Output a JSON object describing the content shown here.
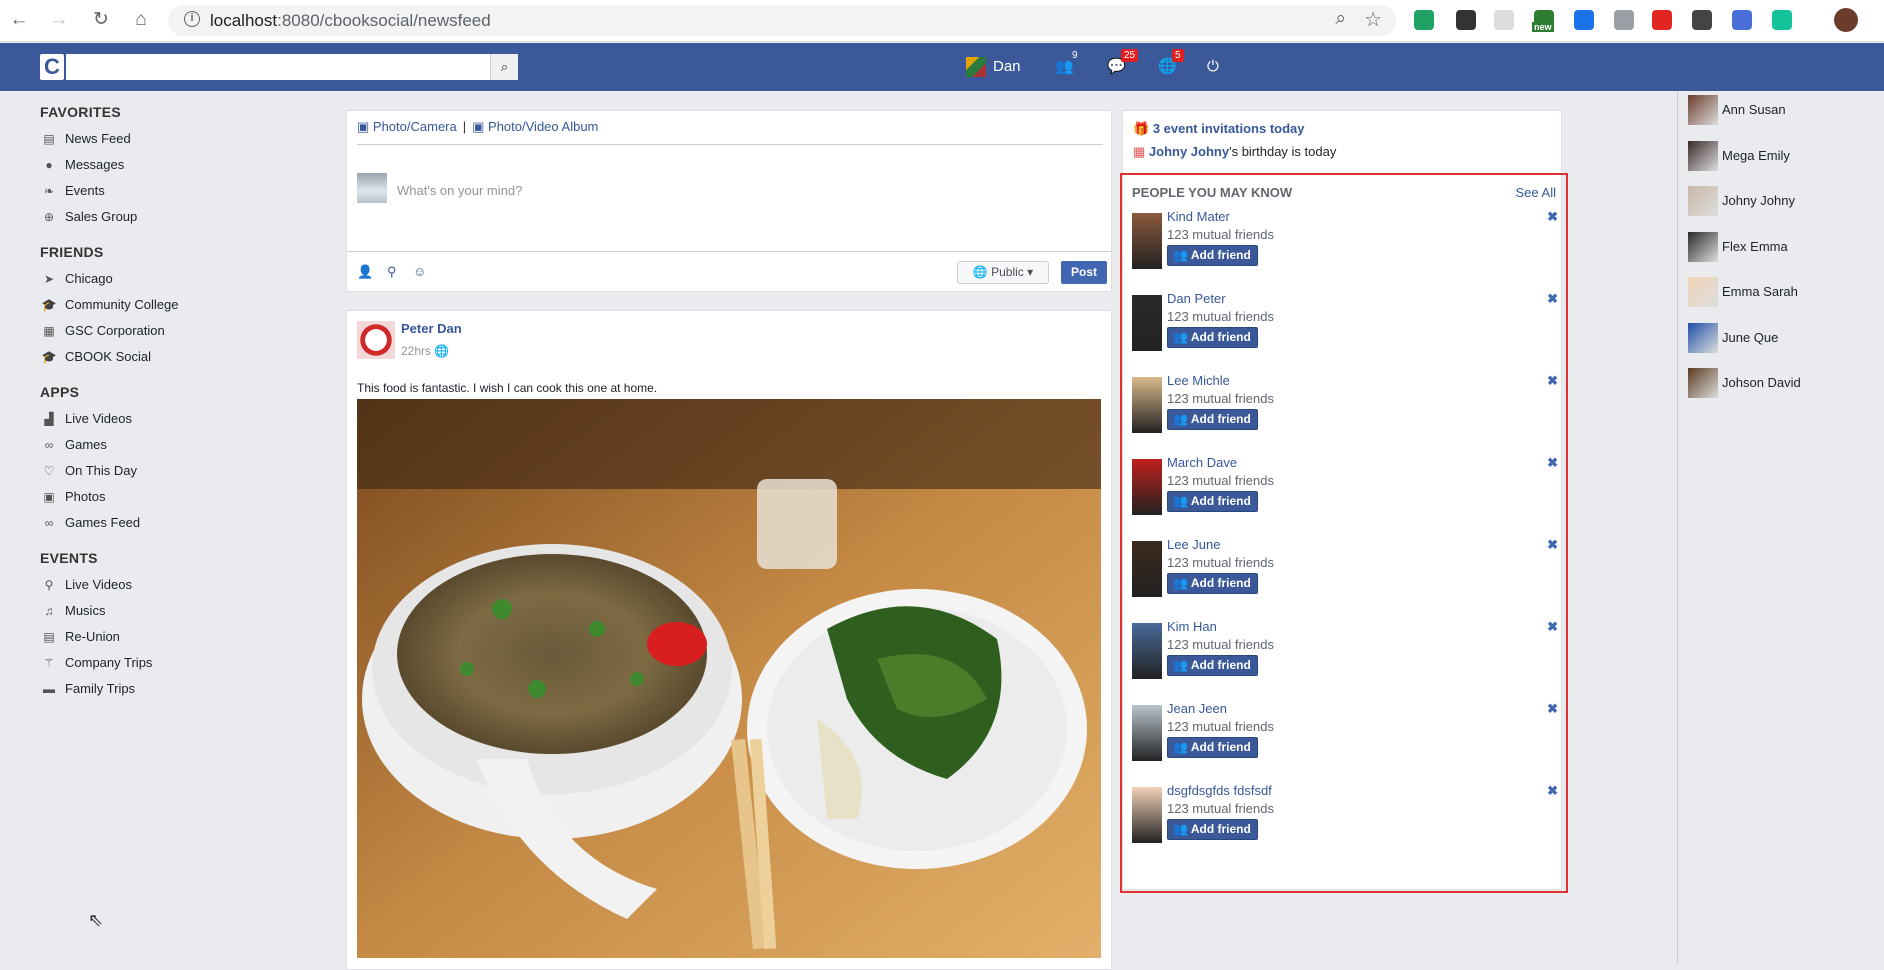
{
  "browser": {
    "url_host": "localhost",
    "url_path": ":8080/cbooksocial/newsfeed",
    "extensions": [
      {
        "name": "drive-icon",
        "color": "#1fa463"
      },
      {
        "name": "color-picker-icon",
        "color": "#333333"
      },
      {
        "name": "blank-extension-icon",
        "color": "#dddddd"
      },
      {
        "name": "screenshot-new-icon",
        "color": "#2e7d32",
        "badge": "new"
      },
      {
        "name": "shield-icon",
        "color": "#1a73e8"
      },
      {
        "name": "camera-icon",
        "color": "#9aa0a6"
      },
      {
        "name": "opera-icon",
        "color": "#e2261f"
      },
      {
        "name": "json-icon",
        "color": "#444444"
      },
      {
        "name": "cube-icon",
        "color": "#4a6fd8"
      },
      {
        "name": "grammarly-icon",
        "color": "#15c39a"
      }
    ]
  },
  "topnav": {
    "logo": "C",
    "search_placeholder": "",
    "user_name": "Dan",
    "friend_requests_count": "9",
    "messages_count": "25",
    "notifications_count": "5"
  },
  "leftnav": {
    "favorites_title": "FAVORITES",
    "favorites": [
      {
        "label": "News Feed",
        "icon": "news-feed-icon",
        "glyph": "▤"
      },
      {
        "label": "Messages",
        "icon": "messages-icon",
        "glyph": "●"
      },
      {
        "label": "Events",
        "icon": "events-icon",
        "glyph": "❧"
      },
      {
        "label": "Sales Group",
        "icon": "sales-group-icon",
        "glyph": "⊕"
      }
    ],
    "friends_title": "FRIENDS",
    "friends": [
      {
        "label": "Chicago",
        "icon": "location-arrow-icon",
        "glyph": "➤"
      },
      {
        "label": "Community College",
        "icon": "graduation-cap-icon",
        "glyph": "🎓"
      },
      {
        "label": "GSC Corporation",
        "icon": "building-icon",
        "glyph": "▦"
      },
      {
        "label": "CBOOK Social",
        "icon": "graduation-cap-icon",
        "glyph": "🎓"
      }
    ],
    "apps_title": "APPS",
    "apps": [
      {
        "label": "Live Videos",
        "icon": "chart-icon",
        "glyph": "▟"
      },
      {
        "label": "Games",
        "icon": "gamepad-icon",
        "glyph": "∞"
      },
      {
        "label": "On This Day",
        "icon": "heart-icon",
        "glyph": "♡"
      },
      {
        "label": "Photos",
        "icon": "photo-icon",
        "glyph": "▣"
      },
      {
        "label": "Games Feed",
        "icon": "gamepad-icon",
        "glyph": "∞"
      }
    ],
    "events_title": "EVENTS",
    "events": [
      {
        "label": "Live Videos",
        "icon": "bicycle-icon",
        "glyph": "⚲"
      },
      {
        "label": "Musics",
        "icon": "music-icon",
        "glyph": "♫"
      },
      {
        "label": "Re-Union",
        "icon": "calendar-icon",
        "glyph": "▤"
      },
      {
        "label": "Company Trips",
        "icon": "magic-icon",
        "glyph": "⚚"
      },
      {
        "label": "Family Trips",
        "icon": "credit-card-icon",
        "glyph": "▬"
      }
    ]
  },
  "composer": {
    "photo_camera": "Photo/Camera",
    "separator": "|",
    "photo_album": "Photo/Video Album",
    "placeholder": "What's on your mind?",
    "privacy": "Public",
    "post_label": "Post"
  },
  "post": {
    "author": "Peter Dan",
    "time": "22hrs",
    "text": "This food is fantastic. I wish I can cook this one at home."
  },
  "rightcol": {
    "event_invitations": "3 event invitations today",
    "birthday_name": "Johny Johny",
    "birthday_suffix": "'s birthday is today",
    "pymk_title": "PEOPLE YOU MAY KNOW",
    "see_all": "See All",
    "add_label": "Add friend",
    "people": [
      {
        "name": "Kind Mater",
        "mutual": "123 mutual friends",
        "color": "#8b5a3c"
      },
      {
        "name": "Dan Peter",
        "mutual": "123 mutual friends",
        "color": "#2a2a2a"
      },
      {
        "name": "Lee Michle",
        "mutual": "123 mutual friends",
        "color": "#d9b98a"
      },
      {
        "name": "March Dave",
        "mutual": "123 mutual friends",
        "color": "#c0201e"
      },
      {
        "name": "Lee June",
        "mutual": "123 mutual friends",
        "color": "#3b2a1d"
      },
      {
        "name": "Kim Han",
        "mutual": "123 mutual friends",
        "color": "#4a6a9a"
      },
      {
        "name": "Jean Jeen",
        "mutual": "123 mutual friends",
        "color": "#b8c4cc"
      },
      {
        "name": "dsgfdsgfds fdsfsdf",
        "mutual": "123 mutual friends",
        "color": "#f2d3b8"
      }
    ]
  },
  "chat": [
    {
      "name": "Ann Susan",
      "color": "#6b3b2b"
    },
    {
      "name": "Mega Emily",
      "color": "#3a2a2a"
    },
    {
      "name": "Johny Johny",
      "color": "#c9b8a8"
    },
    {
      "name": "Flex Emma",
      "color": "#2b2b2b"
    },
    {
      "name": "Emma Sarah",
      "color": "#f2d3b8"
    },
    {
      "name": "June Que",
      "color": "#1f4fa8"
    },
    {
      "name": "Johson David",
      "color": "#5a3a1e"
    }
  ]
}
